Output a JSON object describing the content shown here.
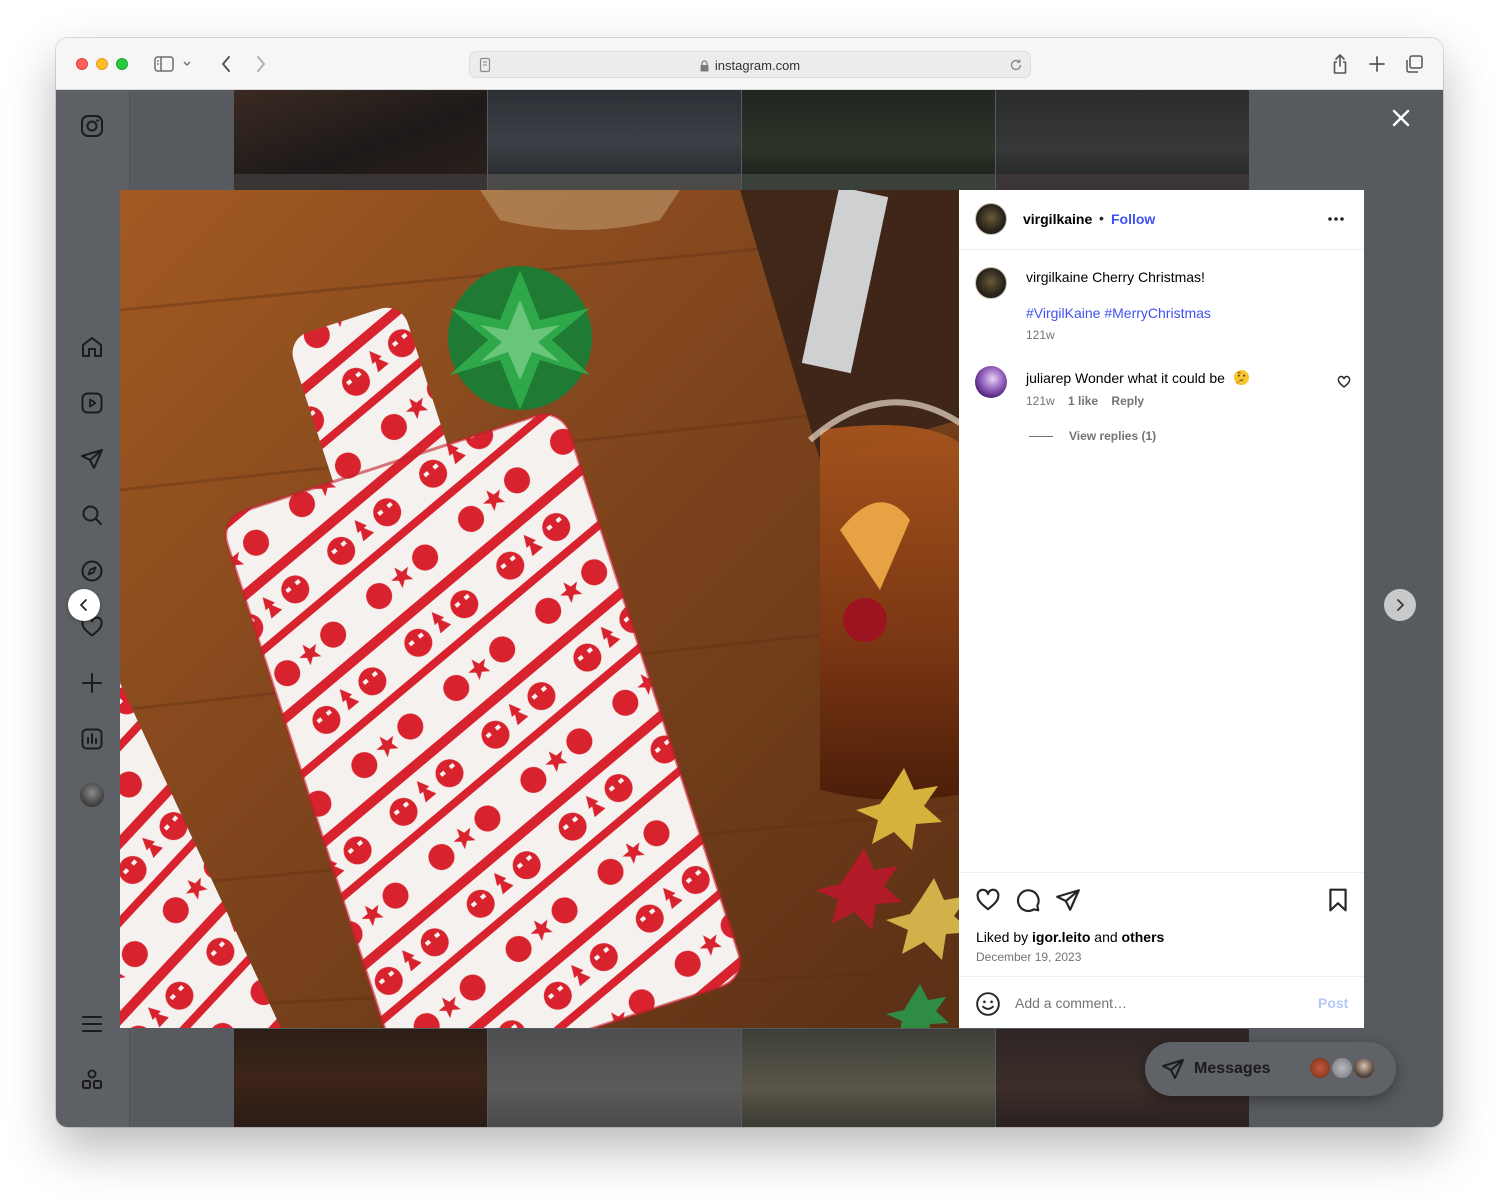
{
  "browser": {
    "url": "instagram.com"
  },
  "post": {
    "owner": "virgilkaine",
    "follow_label": "Follow",
    "separator": "•",
    "caption_user": "virgilkaine",
    "caption_text": "Cherry Christmas!",
    "hashtags": "#VirgilKaine #MerryChristmas",
    "caption_time": "121w",
    "comments": [
      {
        "user": "juliarep",
        "text": "Wonder what it could be",
        "emoji": "thinking-face-emoji",
        "time": "121w",
        "likes": "1 like",
        "reply_label": "Reply",
        "view_replies": "View replies (1)"
      }
    ],
    "liked_by_prefix": "Liked by",
    "liked_by_user": "igor.leito",
    "liked_by_and": "and",
    "liked_by_others": "others",
    "date": "December 19, 2023",
    "comment_placeholder": "Add a comment…",
    "post_label": "Post"
  },
  "messages": {
    "label": "Messages"
  },
  "icons": {
    "sidebar": [
      "instagram-logo-icon",
      "home-icon",
      "reels-icon",
      "direct-icon",
      "search-icon",
      "explore-icon",
      "heart-icon",
      "create-icon",
      "insights-icon",
      "profile-avatar",
      "menu-icon",
      "apps-icon"
    ]
  },
  "colors": {
    "link_blue": "#3f51f0",
    "post_disabled": "#b4c8f8",
    "wrapping_red": "#d8232f"
  }
}
